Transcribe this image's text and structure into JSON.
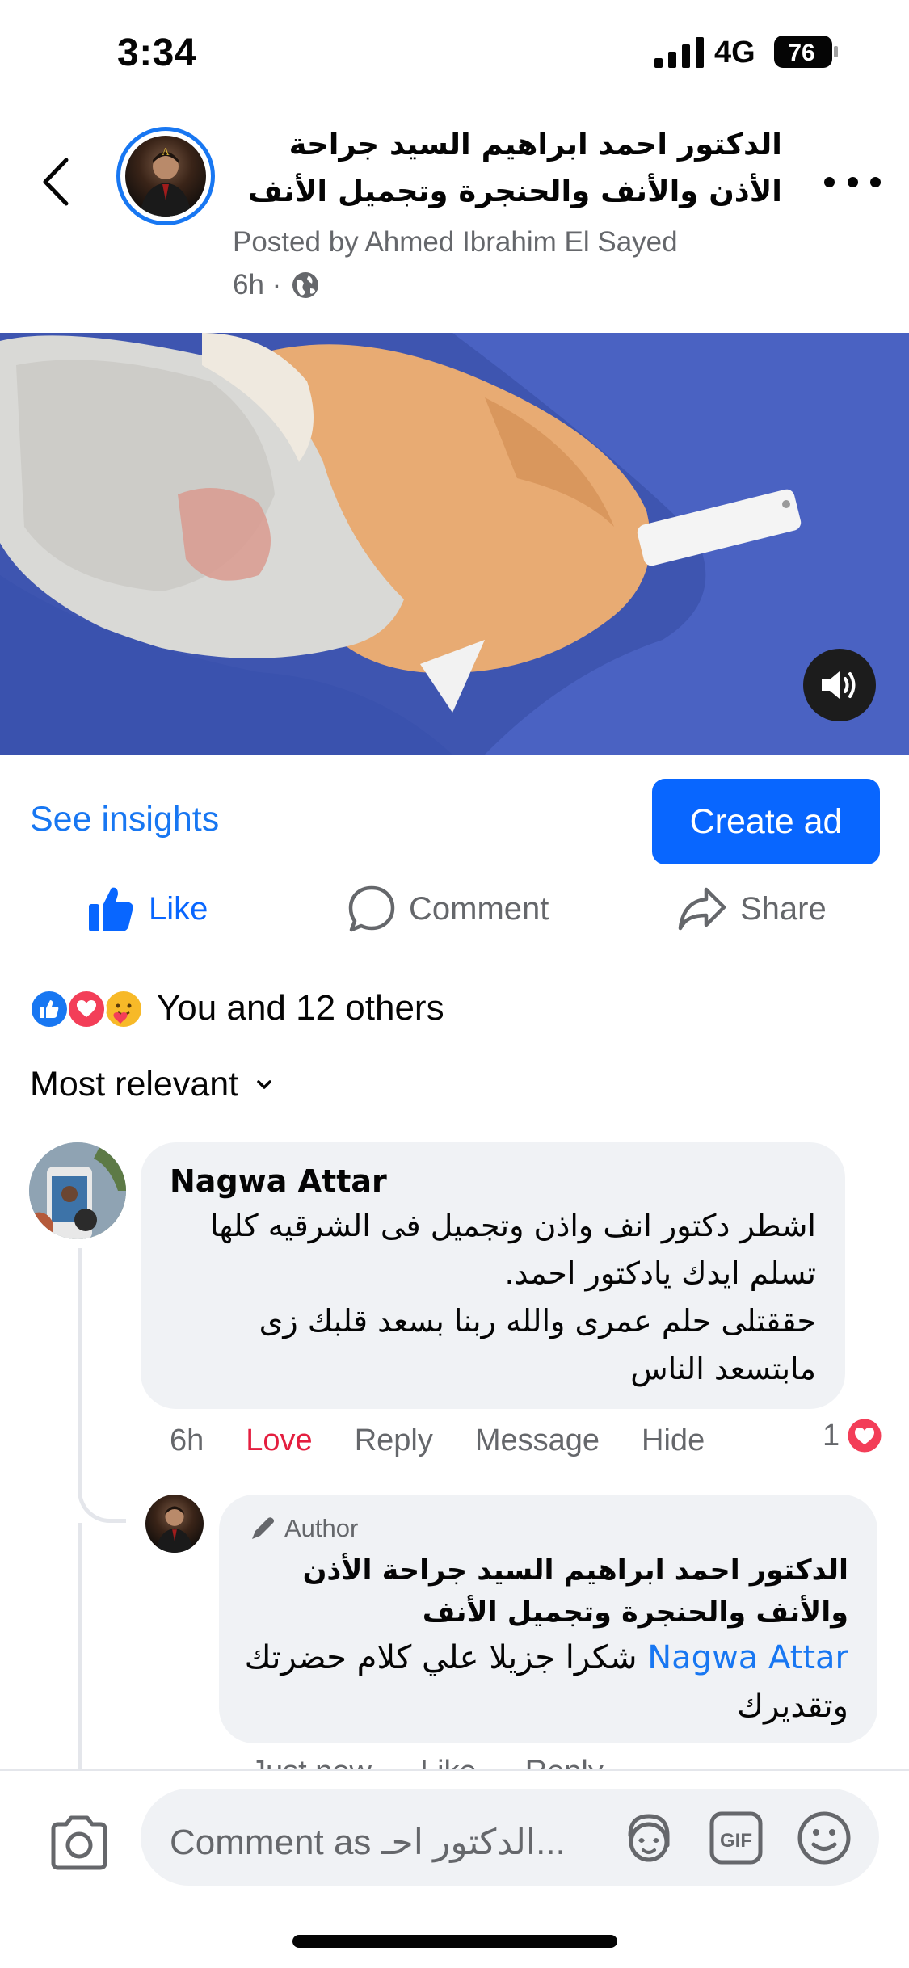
{
  "status": {
    "time": "3:34",
    "network": "4G",
    "battery": "76"
  },
  "post": {
    "page_name": "الدكتور احمد ابراهيم السيد جراحة الأذن والأنف والحنجرة وتجميل الأنف",
    "posted_by": "Posted by Ahmed Ibrahim El Sayed",
    "time": "6h ·",
    "audience_icon": "globe-icon"
  },
  "actions": {
    "see_insights": "See insights",
    "create_ad": "Create ad",
    "like": "Like",
    "comment": "Comment",
    "share": "Share"
  },
  "reactions": {
    "icons": [
      "like",
      "love",
      "care"
    ],
    "summary": "You and 12 others"
  },
  "sort": {
    "label": "Most relevant"
  },
  "comments": [
    {
      "author": "Nagwa Attar",
      "text": "اشطر دكتور انف واذن وتجميل فى الشرقيه كلها تسلم ايدك يادكتور احمد.\nحققتلى حلم عمرى والله ربنا بسعد قلبك زى مابتسعد الناس",
      "time": "6h",
      "reaction_label": "Love",
      "reply": "Reply",
      "message": "Message",
      "hide": "Hide",
      "reaction_count": "1",
      "reaction_type": "love"
    }
  ],
  "reply": {
    "badge": "Author",
    "author": "الدكتور احمد ابراهيم السيد جراحة الأذن والأنف والحنجرة وتجميل الأنف",
    "mention": "Nagwa Attar",
    "text": "شكرا جزيلا علي كلام حضرتك وتقديرك",
    "time": "Just now",
    "like": "Like",
    "reply": "Reply"
  },
  "composer": {
    "placeholder": "Comment as الدكتور احـ..."
  },
  "colors": {
    "brand_blue": "#0866ff",
    "link_blue": "#1877f2",
    "love_red": "#e41e3f",
    "bubble_gray": "#f0f2f5",
    "secondary_text": "#65676b"
  }
}
